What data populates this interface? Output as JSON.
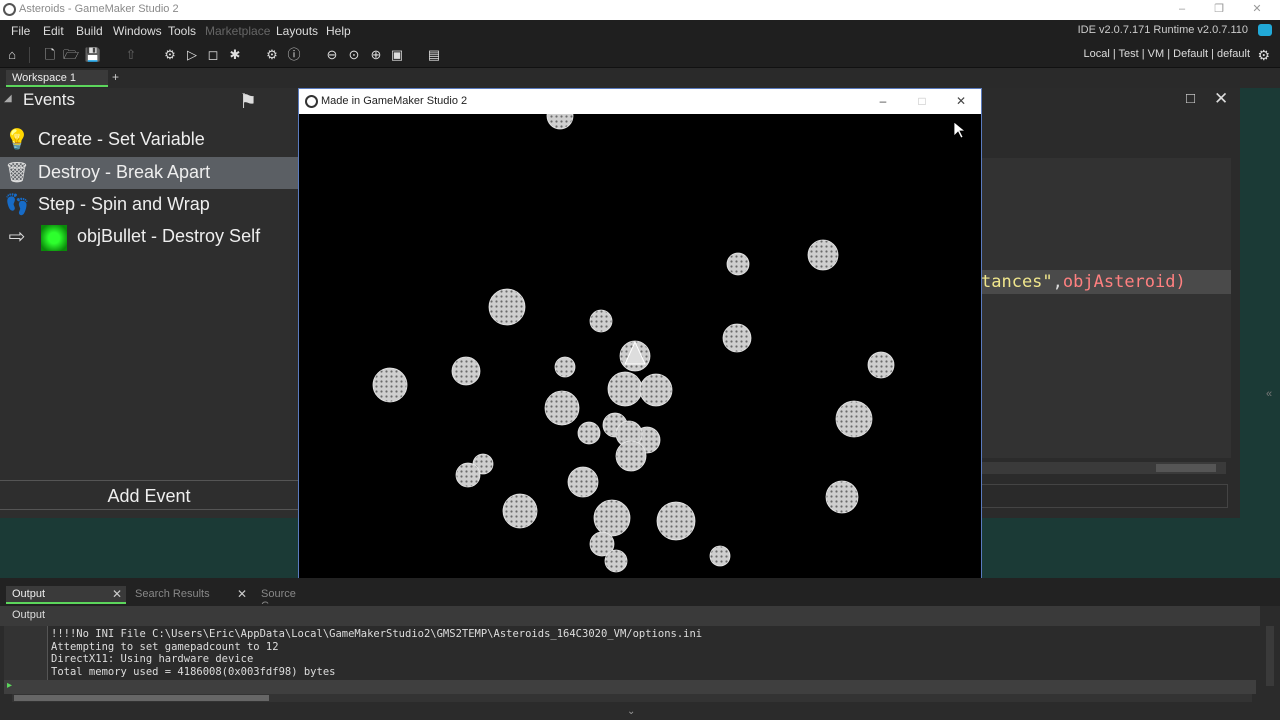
{
  "window": {
    "title": "Asteroids - GameMaker Studio 2"
  },
  "menu": {
    "items": [
      "File",
      "Edit",
      "Build",
      "Windows",
      "Tools",
      "Marketplace",
      "Layouts",
      "Help"
    ],
    "version": "IDE v2.0.7.171 Runtime v2.0.7.110"
  },
  "toolbar": {
    "targets": "Local | Test | VM | Default | default"
  },
  "workspace": {
    "tab_label": "Workspace 1",
    "add_label": "+"
  },
  "events": {
    "title": "Events",
    "items": [
      {
        "label": "Create - Set Variable",
        "icon": "lightbulb-icon"
      },
      {
        "label": "Destroy - Break Apart",
        "icon": "trash-icon"
      },
      {
        "label": "Step - Spin and Wrap",
        "icon": "footsteps-icon"
      },
      {
        "label": "objBullet - Destroy Self",
        "icon": "collision-icon"
      }
    ],
    "add_label": "Add Event"
  },
  "code": {
    "frag1": "tances\"",
    "frag2": ",",
    "frag3": "objAsteroid)"
  },
  "game_window": {
    "title": "Made in GameMaker Studio 2"
  },
  "bottom": {
    "tabs": [
      "Output",
      "Search Results",
      "Source C"
    ],
    "header": "Output",
    "lines": [
      "!!!!No INI File C:\\Users\\Eric\\AppData\\Local\\GameMakerStudio2\\GMS2TEMP\\Asteroids_164C3020_VM/options.ini",
      "Attempting to set gamepadcount to 12",
      "DirectX11: Using hardware device",
      "Total memory used = 4186008(0x003fdf98) bytes"
    ]
  },
  "colors": {
    "accent": "#5cd65c",
    "selected_row": "#5b5f64",
    "game_border": "#5a7bbf",
    "workspace_bg": "#1b3a36"
  }
}
